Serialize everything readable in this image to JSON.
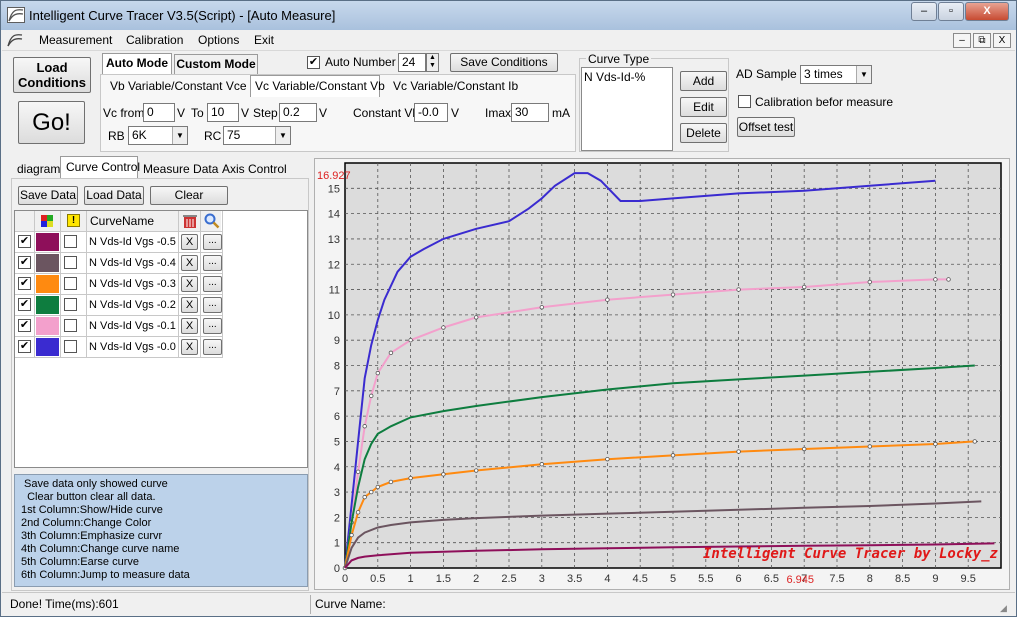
{
  "window": {
    "title": "Intelligent Curve Tracer V3.5(Script) - [Auto Measure]",
    "controls": [
      "–",
      "▫",
      "X"
    ],
    "mdi_controls": [
      "–",
      "⧉",
      "X"
    ]
  },
  "menu": {
    "items": [
      "Measurement",
      "Calibration",
      "Options",
      "Exit"
    ]
  },
  "left_buttons": {
    "load_conditions": "Load Conditions",
    "go": "Go!"
  },
  "mode_tabs": [
    "Auto Mode",
    "Custom Mode"
  ],
  "auto_number": {
    "label": "Auto Number",
    "checked": true,
    "value": "24"
  },
  "save_conditions": "Save Conditions",
  "variable_tabs": [
    "Vb Variable/Constant Vce",
    "Vc Variable/Constant Vb",
    "Vc Variable/Constant Ib"
  ],
  "params": {
    "vc_from_label": "Vc from",
    "vc_from": "0",
    "v1": "V",
    "to_label": "To",
    "to": "10",
    "v2": "V",
    "step_label": "Step",
    "step": "0.2",
    "v3": "V",
    "const_vb_label": "Constant Vb",
    "const_vb": "-0.0",
    "v4": "V",
    "imax_label": "Imax",
    "imax": "30",
    "ma": "mA",
    "rb_label": "RB",
    "rb": "6K",
    "rc_label": "RC",
    "rc": "75"
  },
  "curve_type": {
    "label": "Curve Type",
    "value": "N Vds-Id-%",
    "add": "Add",
    "edit": "Edit",
    "delete": "Delete"
  },
  "ad_sample": {
    "label": "AD Sample",
    "value": "3 times",
    "calibration_label": "Calibration befor measure",
    "calibration_checked": false,
    "offset_test": "Offset test"
  },
  "side_tabs": [
    "diagram",
    "Curve Control",
    "Measure Data",
    "Axis Control"
  ],
  "side_toolbar": {
    "save": "Save Data",
    "load": "Load Data",
    "clear": "Clear"
  },
  "curve_table": {
    "header_name": "CurveName",
    "header_warn": "!",
    "rows": [
      {
        "name": "N Vds-Id Vgs -0.5",
        "color": "#8e0f5a",
        "shown": true,
        "x": "X",
        "more": "..."
      },
      {
        "name": "N Vds-Id Vgs -0.4",
        "color": "#6b5560",
        "shown": true,
        "x": "X",
        "more": "..."
      },
      {
        "name": "N Vds-Id Vgs -0.3",
        "color": "#ff8a10",
        "shown": true,
        "x": "X",
        "more": "..."
      },
      {
        "name": "N Vds-Id Vgs -0.2",
        "color": "#0e7d3f",
        "shown": true,
        "x": "X",
        "more": "..."
      },
      {
        "name": "N Vds-Id Vgs -0.1",
        "color": "#f3a0cc",
        "shown": true,
        "x": "X",
        "more": "..."
      },
      {
        "name": "N Vds-Id Vgs -0.0",
        "color": "#3a2bd0",
        "shown": true,
        "x": "X",
        "more": "..."
      }
    ]
  },
  "help_text": [
    " Save data only showed curve",
    "  Clear button clear all data.",
    "1st Column:Show/Hide curve",
    "2nd Column:Change Color",
    "3th Column:Emphasize curvr",
    "4th Column:Change curve name",
    "5th Column:Earse curve",
    "6th Column:Jump to measure data"
  ],
  "status": {
    "left": "Done!  Time(ms):601",
    "curve_name_label": "Curve Name:"
  },
  "chart_data": {
    "type": "line",
    "watermark": "Intelligent Curve Tracer by Locky_z",
    "top_label": "16.927",
    "bottom_label": "6.945",
    "xlim": [
      0,
      10
    ],
    "ylim": [
      0,
      16
    ],
    "x_ticks": [
      "0",
      "0.5",
      "1",
      "1.5",
      "2",
      "2.5",
      "3",
      "3.5",
      "4",
      "4.5",
      "5",
      "5.5",
      "6",
      "6.5",
      "7",
      "7.5",
      "8",
      "8.5",
      "9",
      "9.5"
    ],
    "y_ticks": [
      "0",
      "1",
      "2",
      "3",
      "4",
      "5",
      "6",
      "7",
      "8",
      "9",
      "10",
      "11",
      "12",
      "13",
      "14",
      "15"
    ],
    "grid": true,
    "series": [
      {
        "name": "N Vds-Id Vgs -0.0",
        "color": "#3a2bd0",
        "markers": false,
        "x": [
          0,
          0.1,
          0.2,
          0.3,
          0.4,
          0.5,
          0.6,
          0.8,
          1.0,
          1.2,
          1.5,
          2.0,
          2.5,
          2.8,
          3.0,
          3.2,
          3.5,
          3.7,
          3.9,
          4.2,
          4.5,
          5.0,
          5.5,
          6.0,
          7.0,
          8.0,
          9.0
        ],
        "y": [
          0,
          2.5,
          5.0,
          7.5,
          8.8,
          9.8,
          10.6,
          11.7,
          12.3,
          12.6,
          13.0,
          13.4,
          13.7,
          14.2,
          14.6,
          15.1,
          15.6,
          15.6,
          15.3,
          14.5,
          14.5,
          14.6,
          14.7,
          14.8,
          14.9,
          15.1,
          15.3
        ]
      },
      {
        "name": "N Vds-Id Vgs -0.1",
        "color": "#f3a0cc",
        "markers": true,
        "x": [
          0,
          0.1,
          0.2,
          0.3,
          0.4,
          0.5,
          0.7,
          1.0,
          1.5,
          2.0,
          3.0,
          4.0,
          5.0,
          6.0,
          7.0,
          8.0,
          9.0,
          9.2
        ],
        "y": [
          0,
          1.8,
          3.8,
          5.6,
          6.8,
          7.7,
          8.5,
          9.0,
          9.5,
          9.9,
          10.3,
          10.6,
          10.8,
          11.0,
          11.1,
          11.3,
          11.4,
          11.4
        ]
      },
      {
        "name": "N Vds-Id Vgs -0.2",
        "color": "#0e7d3f",
        "markers": false,
        "x": [
          0,
          0.1,
          0.2,
          0.3,
          0.4,
          0.5,
          0.7,
          1.0,
          1.5,
          2.0,
          3.0,
          4.0,
          5.0,
          6.0,
          7.0,
          8.0,
          9.0,
          9.6
        ],
        "y": [
          0,
          1.8,
          3.2,
          4.3,
          4.9,
          5.3,
          5.6,
          5.95,
          6.2,
          6.4,
          6.75,
          7.05,
          7.3,
          7.45,
          7.6,
          7.75,
          7.9,
          8.0
        ]
      },
      {
        "name": "N Vds-Id Vgs -0.3",
        "color": "#ff8a10",
        "markers": true,
        "x": [
          0,
          0.1,
          0.2,
          0.3,
          0.4,
          0.5,
          0.7,
          1.0,
          1.5,
          2.0,
          3.0,
          4.0,
          5.0,
          6.0,
          7.0,
          8.0,
          9.0,
          9.6
        ],
        "y": [
          0,
          1.3,
          2.2,
          2.8,
          3.0,
          3.2,
          3.4,
          3.55,
          3.7,
          3.85,
          4.1,
          4.3,
          4.45,
          4.6,
          4.7,
          4.8,
          4.9,
          5.0
        ]
      },
      {
        "name": "N Vds-Id Vgs -0.4",
        "color": "#6b5560",
        "markers": false,
        "x": [
          0,
          0.1,
          0.2,
          0.3,
          0.5,
          0.7,
          1.0,
          1.5,
          2.0,
          3.0,
          4.0,
          5.0,
          6.0,
          7.0,
          8.0,
          9.0,
          9.7
        ],
        "y": [
          0,
          0.8,
          1.2,
          1.4,
          1.6,
          1.7,
          1.8,
          1.9,
          1.97,
          2.07,
          2.15,
          2.22,
          2.3,
          2.38,
          2.45,
          2.55,
          2.63
        ]
      },
      {
        "name": "N Vds-Id Vgs -0.5",
        "color": "#8e0f5a",
        "markers": false,
        "x": [
          0,
          0.1,
          0.2,
          0.3,
          0.5,
          1.0,
          2.0,
          3.0,
          4.0,
          5.0,
          6.0,
          7.0,
          8.0,
          9.0,
          9.9
        ],
        "y": [
          0,
          0.3,
          0.4,
          0.45,
          0.5,
          0.6,
          0.68,
          0.74,
          0.78,
          0.82,
          0.85,
          0.88,
          0.9,
          0.93,
          0.97
        ]
      }
    ]
  }
}
